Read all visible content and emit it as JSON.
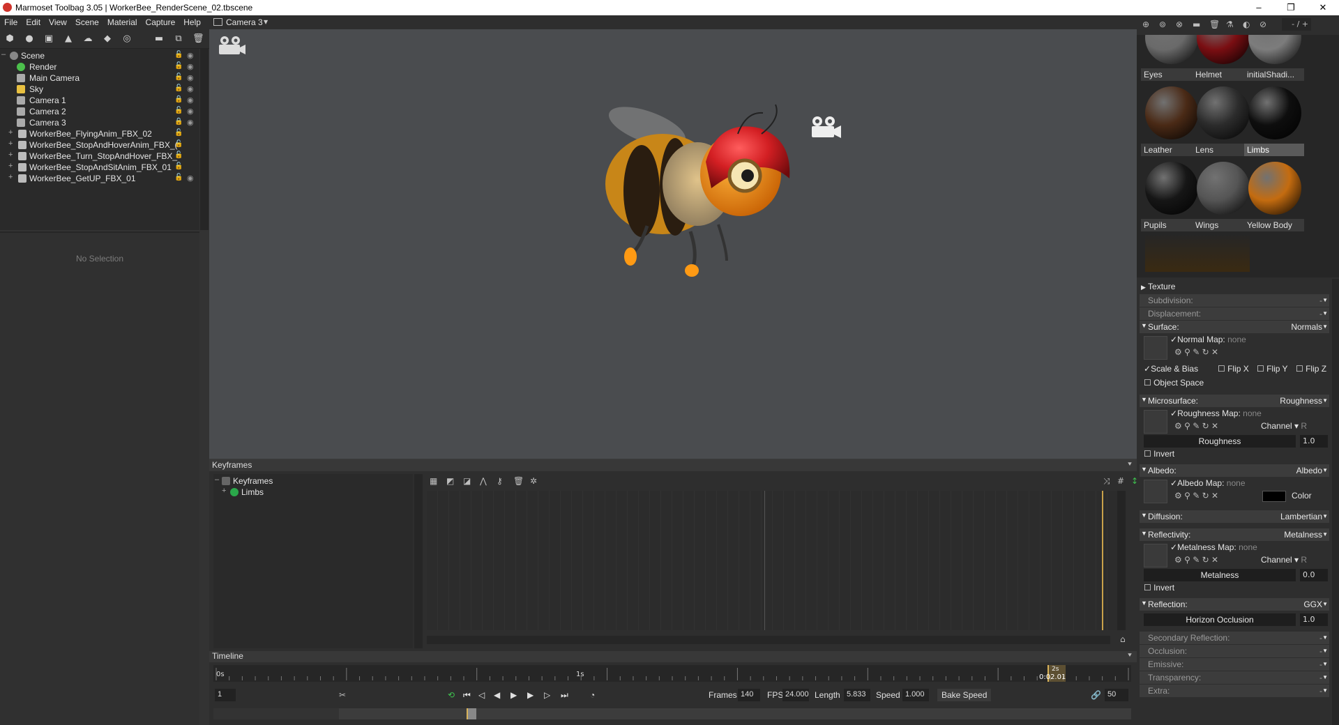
{
  "window": {
    "title": "Marmoset Toolbag 3.05 | WorkerBee_RenderScene_02.tbscene",
    "minimize": "–",
    "restore": "❐",
    "close": "✕"
  },
  "menu": [
    "File",
    "Edit",
    "View",
    "Scene",
    "Material",
    "Capture",
    "Help"
  ],
  "viewport_tab": "Camera 3",
  "scene": {
    "items": [
      {
        "name": "Scene",
        "expander": "–",
        "type": "scene"
      },
      {
        "name": "Render",
        "type": "render"
      },
      {
        "name": "Main Camera",
        "type": "camera"
      },
      {
        "name": "Sky",
        "type": "sky"
      },
      {
        "name": "Camera 1",
        "type": "camera",
        "locked": true
      },
      {
        "name": "Camera 2",
        "type": "camera"
      },
      {
        "name": "Camera 3",
        "type": "camera",
        "locked": true
      },
      {
        "name": "WorkerBee_FlyingAnim_FBX_02",
        "type": "object",
        "expander": "+"
      },
      {
        "name": "WorkerBee_StopAndHoverAnim_FBX_(",
        "type": "object",
        "expander": "+"
      },
      {
        "name": "WorkerBee_Turn_StopAndHover_FBX_",
        "type": "object",
        "expander": "+"
      },
      {
        "name": "WorkerBee_StopAndSitAnim_FBX_01",
        "type": "object",
        "expander": "+"
      },
      {
        "name": "WorkerBee_GetUP_FBX_01",
        "type": "object",
        "expander": "+"
      }
    ]
  },
  "selection_empty": "No Selection",
  "keyframes": {
    "title": "Keyframes",
    "tree": [
      {
        "name": "Keyframes",
        "expander": "–"
      },
      {
        "name": "Limbs",
        "expander": "+"
      }
    ]
  },
  "timeline": {
    "title": "Timeline",
    "ticks": [
      "0s",
      "1s",
      "2s"
    ],
    "current_time": "0:02.01",
    "frame": "1",
    "frames_label": "Frames",
    "frames": "140",
    "fps_label": "FPS",
    "fps": "24.000",
    "length_label": "Length",
    "length": "5.833",
    "speed_label": "Speed",
    "speed": "1.000",
    "bake_speed": "Bake Speed",
    "link_value": "50",
    "playhead_fraction": 0.93
  },
  "materials": {
    "page": "- / +",
    "items": [
      {
        "name": "Eyes",
        "color": "#6a6a6a"
      },
      {
        "name": "Helmet",
        "color": "#7a0e12"
      },
      {
        "name": "initialShadi...",
        "color": "#7c7c7c"
      },
      {
        "name": "Leather",
        "color": "#4a2a16"
      },
      {
        "name": "Lens",
        "color": "#2c2c2c"
      },
      {
        "name": "Limbs",
        "color": "#0e0e0e",
        "selected": true
      },
      {
        "name": "Pupils",
        "color": "#161616"
      },
      {
        "name": "Wings",
        "color": "#555555"
      },
      {
        "name": "Yellow Body",
        "color": "#c46c10"
      }
    ]
  },
  "props": {
    "texture": "Texture",
    "subdivision": "Subdivision:",
    "displacement": "Displacement:",
    "dash": "-",
    "surface": {
      "label": "Surface:",
      "value": "Normals"
    },
    "normal_map": "Normal Map:",
    "none": "none",
    "scale_bias": "Scale & Bias",
    "flip_x": "Flip X",
    "flip_y": "Flip Y",
    "flip_z": "Flip Z",
    "object_space": "Object Space",
    "microsurface": {
      "label": "Microsurface:",
      "value": "Roughness"
    },
    "roughness_map": "Roughness Map:",
    "channel": "Channel",
    "channel_r": "R",
    "roughness": {
      "label": "Roughness",
      "value": "1.0"
    },
    "invert": "Invert",
    "albedo": {
      "label": "Albedo:",
      "value": "Albedo"
    },
    "albedo_map": "Albedo Map:",
    "color": "Color",
    "albedo_color": "#000000",
    "diffusion": {
      "label": "Diffusion:",
      "value": "Lambertian"
    },
    "reflectivity": {
      "label": "Reflectivity:",
      "value": "Metalness"
    },
    "metalness_map": "Metalness Map:",
    "metalness": {
      "label": "Metalness",
      "value": "0.0"
    },
    "reflection": {
      "label": "Reflection:",
      "value": "GGX"
    },
    "horizon_occlusion": {
      "label": "Horizon Occlusion",
      "value": "1.0"
    },
    "secondary_reflection": "Secondary Reflection:",
    "occlusion": "Occlusion:",
    "emissive": "Emissive:",
    "transparency": "Transparency:",
    "extra": "Extra:"
  }
}
